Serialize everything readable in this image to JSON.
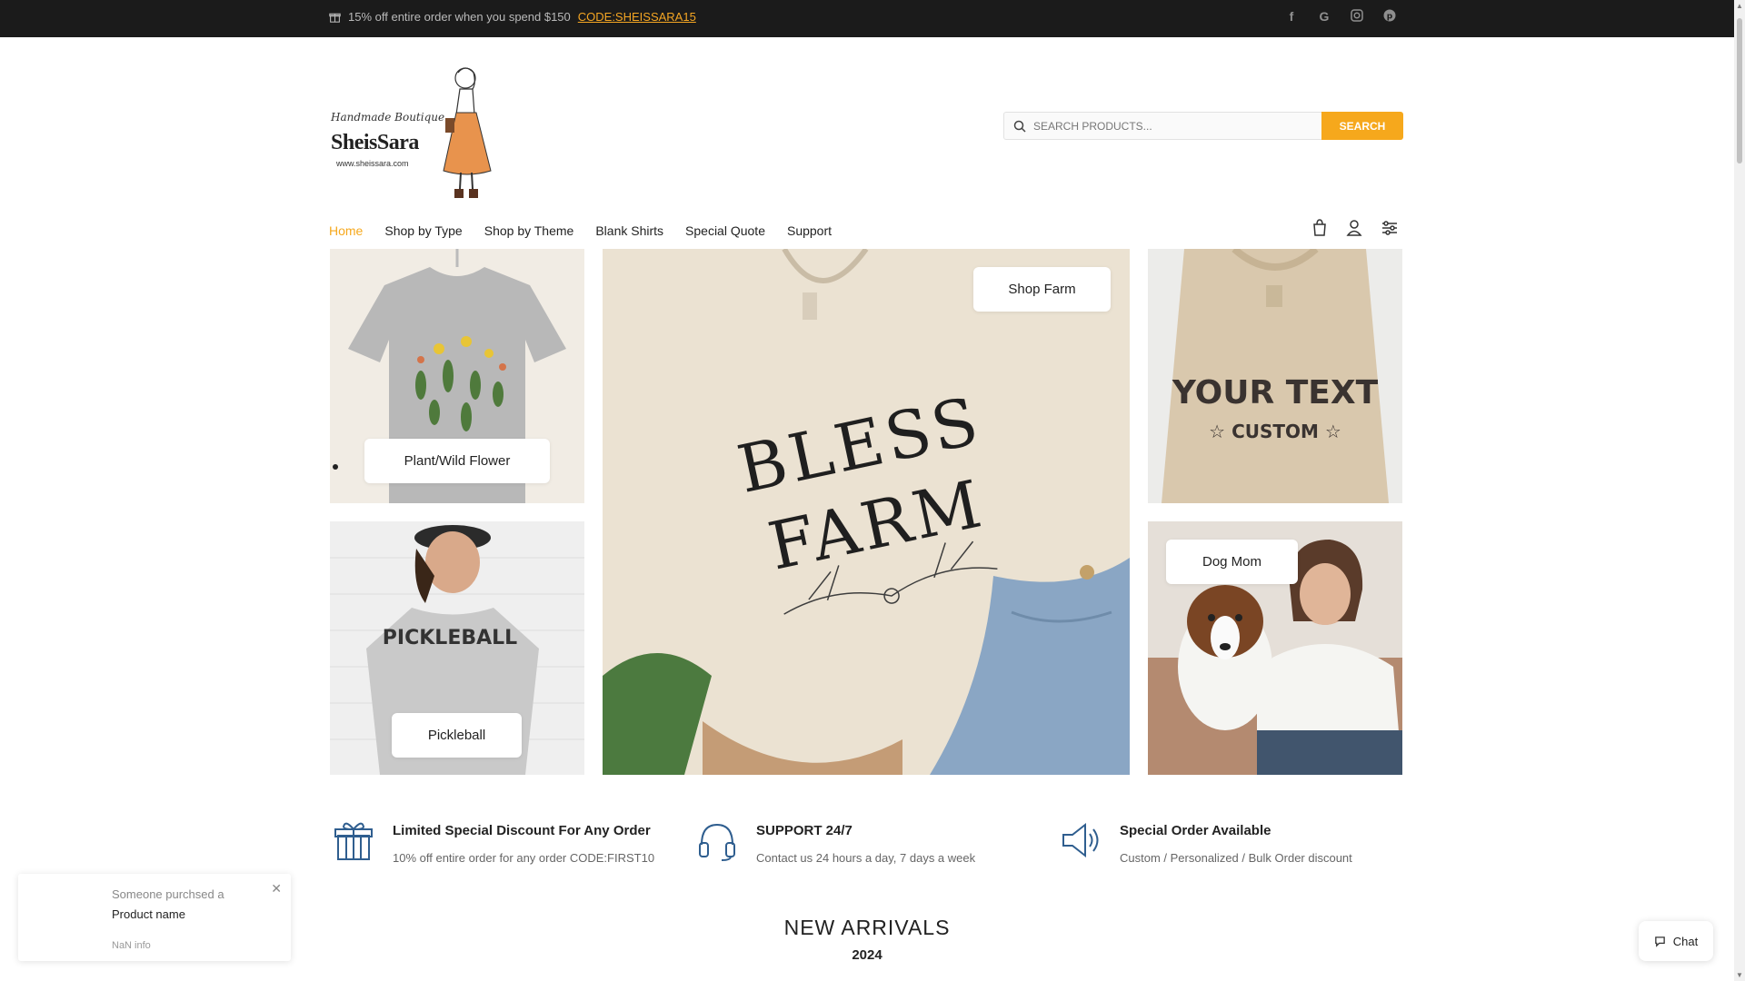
{
  "topbar": {
    "promo_text": "15% off entire order when you spend $150",
    "promo_code": "CODE:SHEISSARA15",
    "socials": [
      "facebook-icon",
      "google-icon",
      "instagram-icon",
      "pinterest-icon"
    ]
  },
  "logo": {
    "script": "Handmade Boutique",
    "brand": "SheisSara",
    "url": "www.sheissara.com"
  },
  "search": {
    "placeholder": "SEARCH PRODUCTS...",
    "button": "SEARCH"
  },
  "nav": {
    "items": [
      "Home",
      "Shop by Type",
      "Shop by Theme",
      "Blank Shirts",
      "Special Quote",
      "Support"
    ],
    "active": "Home"
  },
  "tiles": {
    "plant": "Plant/Wild Flower",
    "pickleball": "Pickleball",
    "farm": "Shop Farm",
    "farm_shirt_line1": "BLESS",
    "farm_shirt_line2": "FARM",
    "custom_line1": "YOUR TEXT",
    "custom_line2": "☆ CUSTOM ☆",
    "pickleball_shirt": "PICKLEBALL",
    "dogmom": "Dog Mom"
  },
  "features": [
    {
      "title": "Limited Special Discount For Any Order",
      "subtitle": "10% off entire order for any order CODE:FIRST10",
      "icon": "gift-icon"
    },
    {
      "title": "SUPPORT 24/7",
      "subtitle": "Contact us 24 hours a day, 7 days a week",
      "icon": "headphones-icon"
    },
    {
      "title": "Special Order Available",
      "subtitle": "Custom / Personalized / Bulk Order discount",
      "icon": "megaphone-icon"
    }
  ],
  "arrivals": {
    "heading": "NEW ARRIVALS",
    "year": "2024"
  },
  "toast": {
    "line1": "Someone purchsed a",
    "line2": "Product name",
    "line3": "NaN info"
  },
  "chat": {
    "label": "Chat"
  },
  "colors": {
    "accent": "#f6a81c",
    "topbar": "#1b1b1b",
    "icon_blue": "#2f5e8f"
  }
}
